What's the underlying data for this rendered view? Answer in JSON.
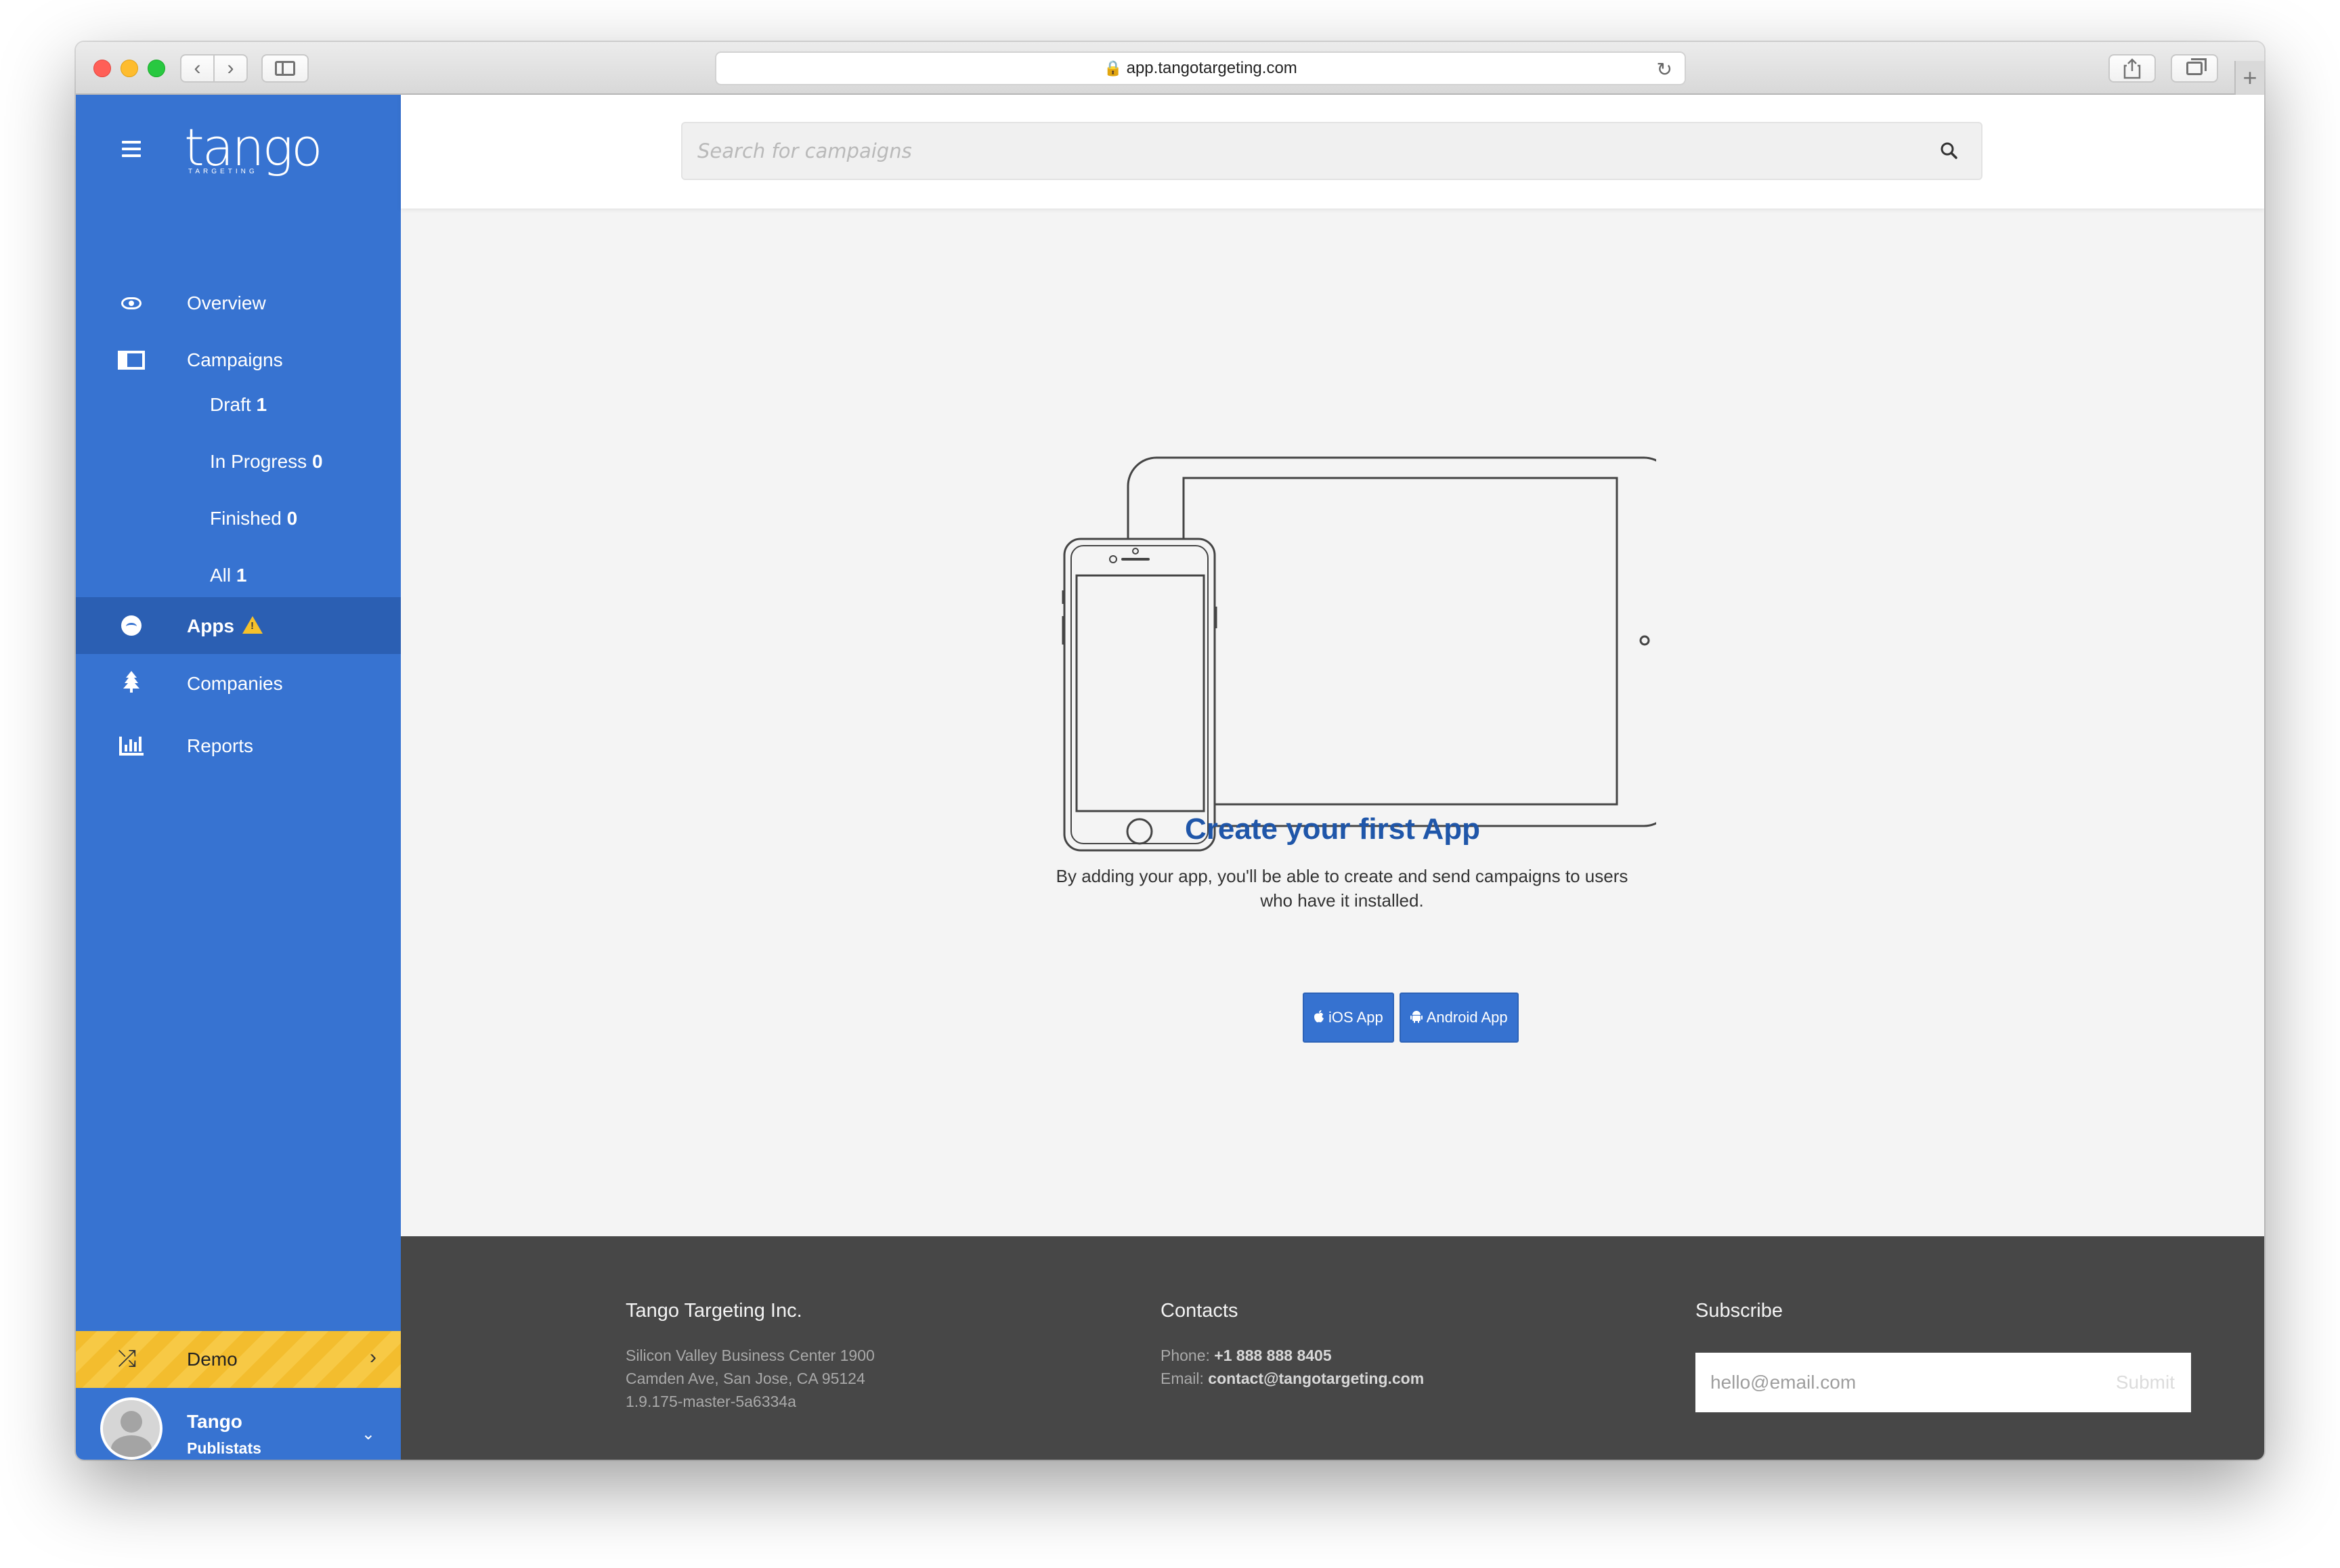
{
  "browser": {
    "url": "app.tangotargeting.com"
  },
  "sidebar": {
    "logo_text": "tango",
    "logo_subtext": "TARGETING",
    "overview_label": "Overview",
    "campaigns_label": "Campaigns",
    "sub_items": [
      {
        "label": "Draft",
        "count": "1"
      },
      {
        "label": "In Progress",
        "count": "0"
      },
      {
        "label": "Finished",
        "count": "0"
      },
      {
        "label": "All",
        "count": "1"
      }
    ],
    "apps_label": "Apps",
    "companies_label": "Companies",
    "reports_label": "Reports",
    "demo_label": "Demo",
    "user": {
      "name": "Tango",
      "org": "Publistats"
    }
  },
  "search": {
    "placeholder": "Search for campaigns"
  },
  "empty_state": {
    "title": "Create your first App",
    "description": "By adding your app, you'll be able to create and send campaigns to users who have it installed.",
    "ios_button": "iOS App",
    "android_button": "Android App"
  },
  "footer": {
    "company": {
      "heading": "Tango Targeting Inc.",
      "line1": "Silicon Valley Business Center 1900",
      "line2": "Camden Ave, San Jose, CA 95124",
      "version": "1.9.175-master-5a6334a"
    },
    "contacts": {
      "heading": "Contacts",
      "phone_label": "Phone:",
      "phone": "+1 888 888 8405",
      "email_label": "Email:",
      "email": "contact@tangotargeting.com"
    },
    "subscribe": {
      "heading": "Subscribe",
      "placeholder": "hello@email.com",
      "button": "Submit"
    }
  },
  "colors": {
    "sidebar": "#3773d1",
    "sidebar_active": "#2b5fb3",
    "title_blue": "#1f56a9",
    "button_blue": "#3672d0",
    "demo_yellow": "#f3bd2e",
    "footer_bg": "#474747"
  }
}
